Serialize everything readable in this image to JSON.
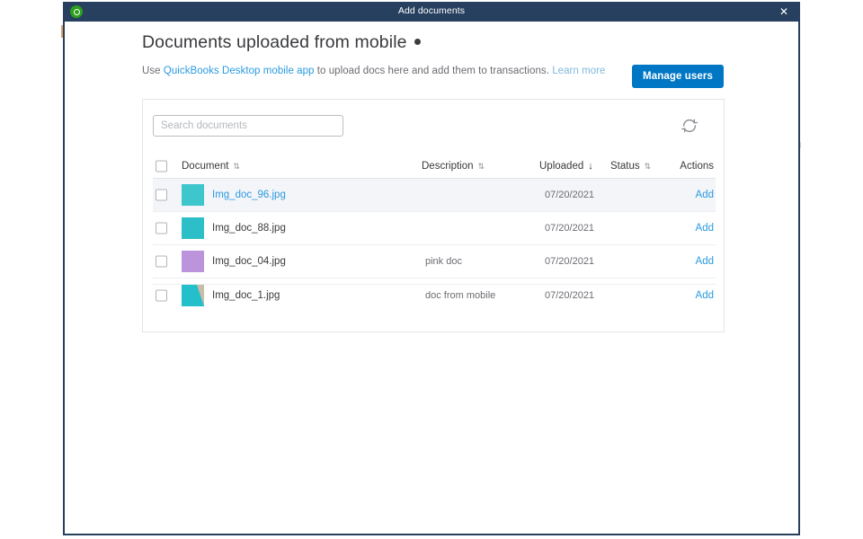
{
  "window": {
    "title": "Add documents",
    "logo_icon": "quickbooks-logo-icon",
    "close_icon": "✕"
  },
  "header": {
    "page_title": "Documents uploaded from mobile",
    "info_icon": "info-dot-icon",
    "subtitle_prefix": "Use ",
    "subtitle_link": "QuickBooks Desktop mobile app",
    "subtitle_middle": " to upload docs here and add them to transactions. ",
    "subtitle_learn_more": "Learn more",
    "manage_users_label": "Manage users",
    "accent_color": "#0077c5",
    "link_color": "#2b9ae0"
  },
  "toolbar": {
    "search_placeholder": "Search documents",
    "search_value": "",
    "refresh_icon": "refresh-icon"
  },
  "table": {
    "columns": [
      {
        "key": "document",
        "label": "Document",
        "sortable": true,
        "sorted": false
      },
      {
        "key": "description",
        "label": "Description",
        "sortable": true,
        "sorted": false
      },
      {
        "key": "uploaded",
        "label": "Uploaded",
        "sortable": true,
        "sorted": "desc"
      },
      {
        "key": "status",
        "label": "Status",
        "sortable": true,
        "sorted": false
      },
      {
        "key": "actions",
        "label": "Actions",
        "sortable": false,
        "sorted": false
      }
    ],
    "sort_desc_glyph": "↓",
    "sort_neutral_glyph": "⇅",
    "select_all_checked": false,
    "rows": [
      {
        "checked": false,
        "highlighted": true,
        "document": "Img_doc_96.jpg",
        "document_is_link": true,
        "description": "",
        "uploaded": "07/20/2021",
        "status": "",
        "action": "Add",
        "thumb": {
          "type": "solid",
          "color": "#3ec6cd"
        }
      },
      {
        "checked": false,
        "highlighted": false,
        "document": "Img_doc_88.jpg",
        "document_is_link": false,
        "description": "",
        "uploaded": "07/20/2021",
        "status": "",
        "action": "Add",
        "thumb": {
          "type": "solid",
          "color": "#2dbfc8"
        }
      },
      {
        "checked": false,
        "highlighted": false,
        "document": "Img_doc_04.jpg",
        "document_is_link": false,
        "description": "pink doc",
        "uploaded": "07/20/2021",
        "status": "",
        "action": "Add",
        "thumb": {
          "type": "solid",
          "color": "#bb94dc"
        }
      },
      {
        "checked": false,
        "highlighted": false,
        "document": "Img_doc_1.jpg",
        "document_is_link": false,
        "description": "doc from mobile",
        "uploaded": "07/20/2021",
        "status": "",
        "action": "Add",
        "thumb": {
          "type": "corner",
          "color": "#23bfcb",
          "corner_color": "#c9bda8"
        }
      }
    ]
  }
}
